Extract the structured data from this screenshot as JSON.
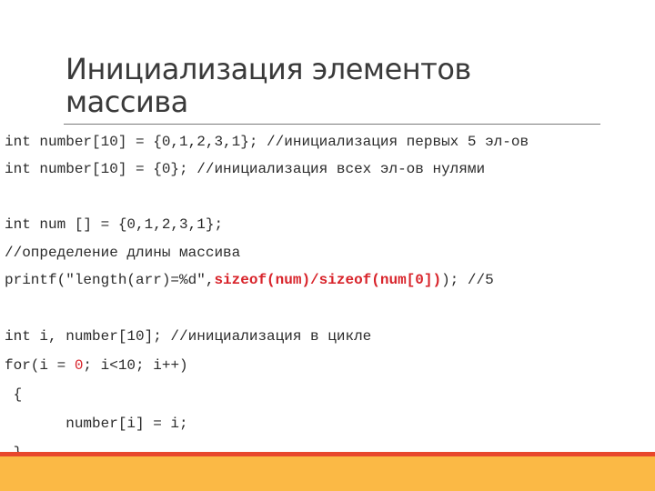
{
  "slide": {
    "title_lines": [
      "Инициализация элементов",
      "массива"
    ],
    "code": {
      "line1": "int number[10] = {0,1,2,3,1}; //инициализация первых 5 эл-ов",
      "line2": "int number[10] = {0}; //инициализация всех эл-ов нулями",
      "line3": "int num [] = {0,1,2,3,1};",
      "line4": "//определение длины массива",
      "line5_pre": "printf(\"length(arr)=%d\",",
      "line5_red": "sizeof(num)/sizeof(num[0])",
      "line5_post": "); //5",
      "line6": "int i, number[10]; //инициализация в цикле",
      "line7_pre": "for(i = ",
      "line7_red": "0",
      "line7_post": "; i<10; i++)",
      "line8": " {",
      "line9": "       number[i] = i;",
      "line10": " }"
    },
    "colors": {
      "accent_red": "#e8472c",
      "accent_orange": "#fbb945",
      "code_highlight": "#d8232a"
    }
  }
}
